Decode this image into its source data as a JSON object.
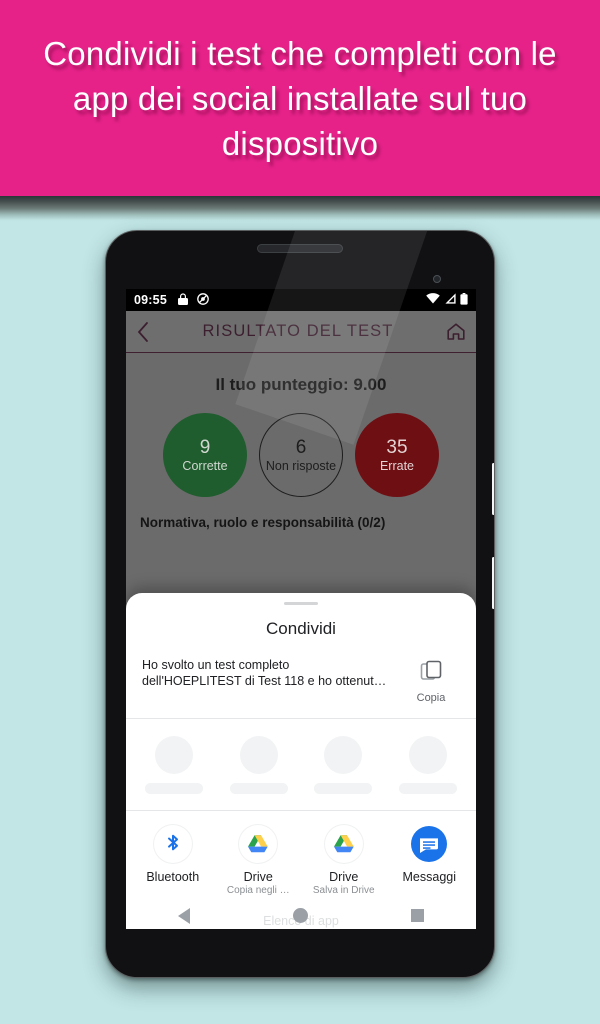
{
  "promo": {
    "headline": "Condividi i test che completi con le app dei social installate sul tuo dispositivo",
    "background_color": "#e62289",
    "text_color": "#ffffff"
  },
  "page_background_color": "#c2e6e6",
  "phone": {
    "status_bar": {
      "clock": "09:55",
      "left_icons": [
        "lock-icon",
        "dnd-silent-icon"
      ],
      "right_icons": [
        "wifi-icon",
        "cellular-signal-icon",
        "battery-icon"
      ],
      "background_color": "#000000",
      "text_color": "#ffffff"
    },
    "app_bar": {
      "back_icon": "chevron-left-icon",
      "title": "RISULTATO DEL TEST",
      "home_icon": "home-icon",
      "background_color": "#6e6e6e",
      "title_color": "#3c1f2e"
    },
    "result": {
      "score_line": "Il tuo punteggio: 9.00",
      "circles": [
        {
          "name": "correct",
          "value": "9",
          "label": "Corrette",
          "color": "#1f5c2e"
        },
        {
          "name": "unanswered",
          "value": "6",
          "label": "Non risposte",
          "color": "transparent"
        },
        {
          "name": "wrong",
          "value": "35",
          "label": "Errate",
          "color": "#6e0f14"
        }
      ],
      "topic_line": "Normativa, ruolo e responsabilità (0/2)"
    },
    "share_sheet": {
      "title": "Condividi",
      "preview_text": "Ho svolto un test completo dell'HOEPLITEST di Test 118 e ho ottenut…",
      "copy_label": "Copia",
      "copy_icon": "copy-icon",
      "skeleton_placeholder_count": 4,
      "apps": [
        {
          "name": "Bluetooth",
          "sub": "",
          "icon": "bluetooth-icon"
        },
        {
          "name": "Drive",
          "sub": "Copia negli …",
          "icon": "google-drive-icon"
        },
        {
          "name": "Drive",
          "sub": "Salva in Drive",
          "icon": "google-drive-icon"
        },
        {
          "name": "Messaggi",
          "sub": "",
          "icon": "google-messages-icon"
        }
      ]
    },
    "nav_bar": {
      "hint_text": "Elenco di app",
      "back_icon": "nav-back-triangle-icon",
      "home_icon": "nav-home-circle-icon",
      "recents_icon": "nav-recents-square-icon"
    }
  }
}
